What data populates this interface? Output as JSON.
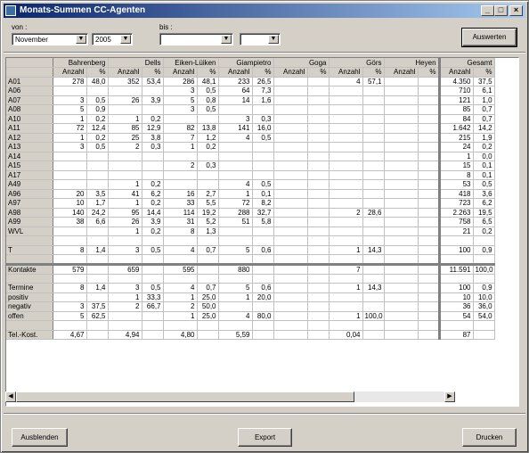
{
  "window": {
    "title": "Monats-Summen CC-Agenten"
  },
  "filters": {
    "von_label": "von :",
    "bis_label": "bis :",
    "von_month": "November",
    "von_year": "2005",
    "bis_month": "",
    "bis_year": ""
  },
  "buttons": {
    "auswerten": "Auswerten",
    "ausblenden": "Ausblenden",
    "export": "Export",
    "drucken": "Drucken"
  },
  "table": {
    "agents": [
      "Bahrenberg",
      "Dells",
      "Eiken-Lüiken",
      "Giampietro",
      "Goga",
      "Görs",
      "Heyen"
    ],
    "total": "Gesamt",
    "sub": [
      "Anzahl",
      "%"
    ],
    "rows": [
      {
        "label": "A01",
        "cells": [
          "278",
          "48,0",
          "352",
          "53,4",
          "286",
          "48,1",
          "233",
          "26,5",
          "",
          "",
          "4",
          "57,1",
          "",
          ""
        ],
        "total": [
          "4.350",
          "37,5"
        ]
      },
      {
        "label": "A06",
        "cells": [
          "",
          "",
          "",
          "",
          "3",
          "0,5",
          "64",
          "7,3",
          "",
          "",
          "",
          "",
          "",
          ""
        ],
        "total": [
          "710",
          "6,1"
        ]
      },
      {
        "label": "A07",
        "cells": [
          "3",
          "0,5",
          "26",
          "3,9",
          "5",
          "0,8",
          "14",
          "1,6",
          "",
          "",
          "",
          "",
          "",
          ""
        ],
        "total": [
          "121",
          "1,0"
        ]
      },
      {
        "label": "A08",
        "cells": [
          "5",
          "0,9",
          "",
          "",
          "3",
          "0,5",
          "",
          "",
          "",
          "",
          "",
          "",
          "",
          ""
        ],
        "total": [
          "85",
          "0,7"
        ]
      },
      {
        "label": "A10",
        "cells": [
          "1",
          "0,2",
          "1",
          "0,2",
          "",
          "",
          "3",
          "0,3",
          "",
          "",
          "",
          "",
          "",
          ""
        ],
        "total": [
          "84",
          "0,7"
        ]
      },
      {
        "label": "A11",
        "cells": [
          "72",
          "12,4",
          "85",
          "12,9",
          "82",
          "13,8",
          "141",
          "16,0",
          "",
          "",
          "",
          "",
          "",
          ""
        ],
        "total": [
          "1.642",
          "14,2"
        ]
      },
      {
        "label": "A12",
        "cells": [
          "1",
          "0,2",
          "25",
          "3,8",
          "7",
          "1,2",
          "4",
          "0,5",
          "",
          "",
          "",
          "",
          "",
          ""
        ],
        "total": [
          "215",
          "1,9"
        ]
      },
      {
        "label": "A13",
        "cells": [
          "3",
          "0,5",
          "2",
          "0,3",
          "1",
          "0,2",
          "",
          "",
          "",
          "",
          "",
          "",
          "",
          ""
        ],
        "total": [
          "24",
          "0,2"
        ]
      },
      {
        "label": "A14",
        "cells": [
          "",
          "",
          "",
          "",
          "",
          "",
          "",
          "",
          "",
          "",
          "",
          "",
          "",
          ""
        ],
        "total": [
          "1",
          "0,0"
        ]
      },
      {
        "label": "A15",
        "cells": [
          "",
          "",
          "",
          "",
          "2",
          "0,3",
          "",
          "",
          "",
          "",
          "",
          "",
          "",
          ""
        ],
        "total": [
          "15",
          "0,1"
        ]
      },
      {
        "label": "A17",
        "cells": [
          "",
          "",
          "",
          "",
          "",
          "",
          "",
          "",
          "",
          "",
          "",
          "",
          "",
          ""
        ],
        "total": [
          "8",
          "0,1"
        ]
      },
      {
        "label": "A49",
        "cells": [
          "",
          "",
          "1",
          "0,2",
          "",
          "",
          "4",
          "0,5",
          "",
          "",
          "",
          "",
          "",
          ""
        ],
        "total": [
          "53",
          "0,5"
        ]
      },
      {
        "label": "A96",
        "cells": [
          "20",
          "3,5",
          "41",
          "6,2",
          "16",
          "2,7",
          "1",
          "0,1",
          "",
          "",
          "",
          "",
          "",
          ""
        ],
        "total": [
          "418",
          "3,6"
        ]
      },
      {
        "label": "A97",
        "cells": [
          "10",
          "1,7",
          "1",
          "0,2",
          "33",
          "5,5",
          "72",
          "8,2",
          "",
          "",
          "",
          "",
          "",
          ""
        ],
        "total": [
          "723",
          "6,2"
        ]
      },
      {
        "label": "A98",
        "cells": [
          "140",
          "24,2",
          "95",
          "14,4",
          "114",
          "19,2",
          "288",
          "32,7",
          "",
          "",
          "2",
          "28,6",
          "",
          ""
        ],
        "total": [
          "2.263",
          "19,5"
        ]
      },
      {
        "label": "A99",
        "cells": [
          "38",
          "6,6",
          "26",
          "3,9",
          "31",
          "5,2",
          "51",
          "5,8",
          "",
          "",
          "",
          "",
          "",
          ""
        ],
        "total": [
          "758",
          "6,5"
        ]
      },
      {
        "label": "WVL",
        "cells": [
          "",
          "",
          "1",
          "0,2",
          "8",
          "1,3",
          "",
          "",
          "",
          "",
          "",
          "",
          "",
          ""
        ],
        "total": [
          "21",
          "0,2"
        ]
      },
      {
        "label": "",
        "cells": [
          "",
          "",
          "",
          "",
          "",
          "",
          "",
          "",
          "",
          "",
          "",
          "",
          "",
          ""
        ],
        "total": [
          "",
          ""
        ]
      },
      {
        "label": "T",
        "cells": [
          "8",
          "1,4",
          "3",
          "0,5",
          "4",
          "0,7",
          "5",
          "0,6",
          "",
          "",
          "1",
          "14,3",
          "",
          ""
        ],
        "total": [
          "100",
          "0,9"
        ]
      },
      {
        "label": "",
        "cells": [
          "",
          "",
          "",
          "",
          "",
          "",
          "",
          "",
          "",
          "",
          "",
          "",
          "",
          ""
        ],
        "total": [
          "",
          ""
        ],
        "sep": true
      },
      {
        "label": "Kontakte",
        "cells": [
          "579",
          "",
          "659",
          "",
          "595",
          "",
          "880",
          "",
          "",
          "",
          "7",
          "",
          "",
          ""
        ],
        "total": [
          "11.591",
          "100,0"
        ]
      },
      {
        "label": "",
        "cells": [
          "",
          "",
          "",
          "",
          "",
          "",
          "",
          "",
          "",
          "",
          "",
          "",
          "",
          ""
        ],
        "total": [
          "",
          ""
        ]
      },
      {
        "label": "Termine",
        "cells": [
          "8",
          "1,4",
          "3",
          "0,5",
          "4",
          "0,7",
          "5",
          "0,6",
          "",
          "",
          "1",
          "14,3",
          "",
          ""
        ],
        "total": [
          "100",
          "0,9"
        ]
      },
      {
        "label": "positiv",
        "cells": [
          "",
          "",
          "1",
          "33,3",
          "1",
          "25,0",
          "1",
          "20,0",
          "",
          "",
          "",
          "",
          "",
          ""
        ],
        "total": [
          "10",
          "10,0"
        ]
      },
      {
        "label": "negativ",
        "cells": [
          "3",
          "37,5",
          "2",
          "66,7",
          "2",
          "50,0",
          "",
          "",
          "",
          "",
          "",
          "",
          "",
          ""
        ],
        "total": [
          "36",
          "36,0"
        ]
      },
      {
        "label": "offen",
        "cells": [
          "5",
          "62,5",
          "",
          "",
          "1",
          "25,0",
          "4",
          "80,0",
          "",
          "",
          "1",
          "100,0",
          "",
          ""
        ],
        "total": [
          "54",
          "54,0"
        ]
      },
      {
        "label": "",
        "cells": [
          "",
          "",
          "",
          "",
          "",
          "",
          "",
          "",
          "",
          "",
          "",
          "",
          "",
          ""
        ],
        "total": [
          "",
          ""
        ]
      },
      {
        "label": "Tel.-Kost.",
        "cells": [
          "4,67",
          "",
          "4,94",
          "",
          "4,80",
          "",
          "5,59",
          "",
          "",
          "",
          "0,04",
          "",
          "",
          ""
        ],
        "total": [
          "87",
          ""
        ]
      }
    ]
  }
}
